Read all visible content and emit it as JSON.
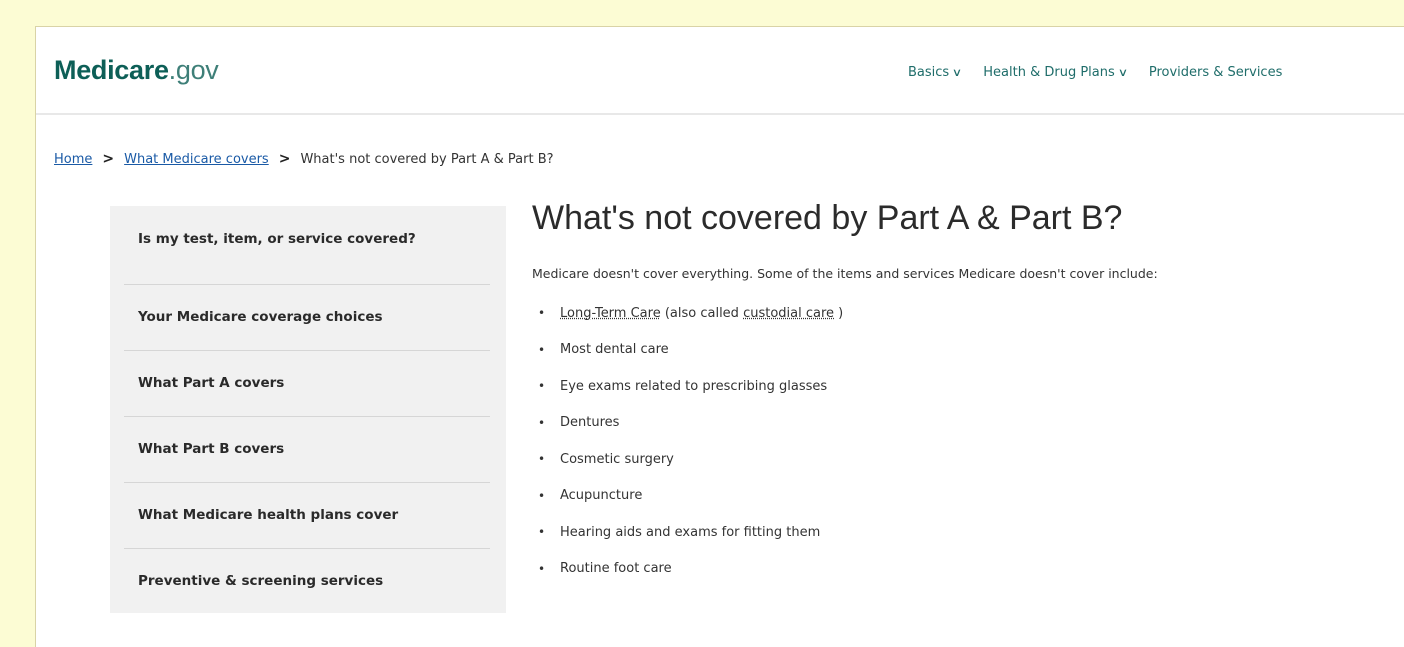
{
  "header": {
    "logo_brand": "Medicare",
    "logo_tld": ".gov",
    "nav": [
      {
        "label": "Basics"
      },
      {
        "label": "Health & Drug Plans"
      },
      {
        "label": "Providers & Services"
      }
    ]
  },
  "breadcrumb": {
    "home": "Home",
    "section": "What Medicare covers",
    "current": "What's not covered by Part A & Part B?",
    "separator": ">"
  },
  "sidebar": {
    "items": [
      {
        "label": "Is my test, item, or service covered?"
      },
      {
        "label": "Your Medicare coverage choices"
      },
      {
        "label": "What Part A covers"
      },
      {
        "label": "What Part B covers"
      },
      {
        "label": "What Medicare health plans cover"
      },
      {
        "label": "Preventive & screening services"
      }
    ]
  },
  "main": {
    "title": "What's not covered by Part A & Part B?",
    "intro": "Medicare doesn't cover everything. Some of the items and services Medicare doesn't cover include:",
    "first_item": {
      "link": "Long-Term Care",
      "mid": " (also called ",
      "link2": "custodial care",
      "end": " )"
    },
    "items": [
      "Most dental care",
      "Eye exams related to prescribing glasses",
      "Dentures",
      "Cosmetic surgery",
      "Acupuncture",
      "Hearing aids and exams for fitting them",
      "Routine foot care"
    ]
  },
  "colors": {
    "page_bg": "#fcfcd4",
    "brand": "#0d5f57",
    "link": "#1a5aa6",
    "sidebar_bg": "#f1f1f1"
  }
}
